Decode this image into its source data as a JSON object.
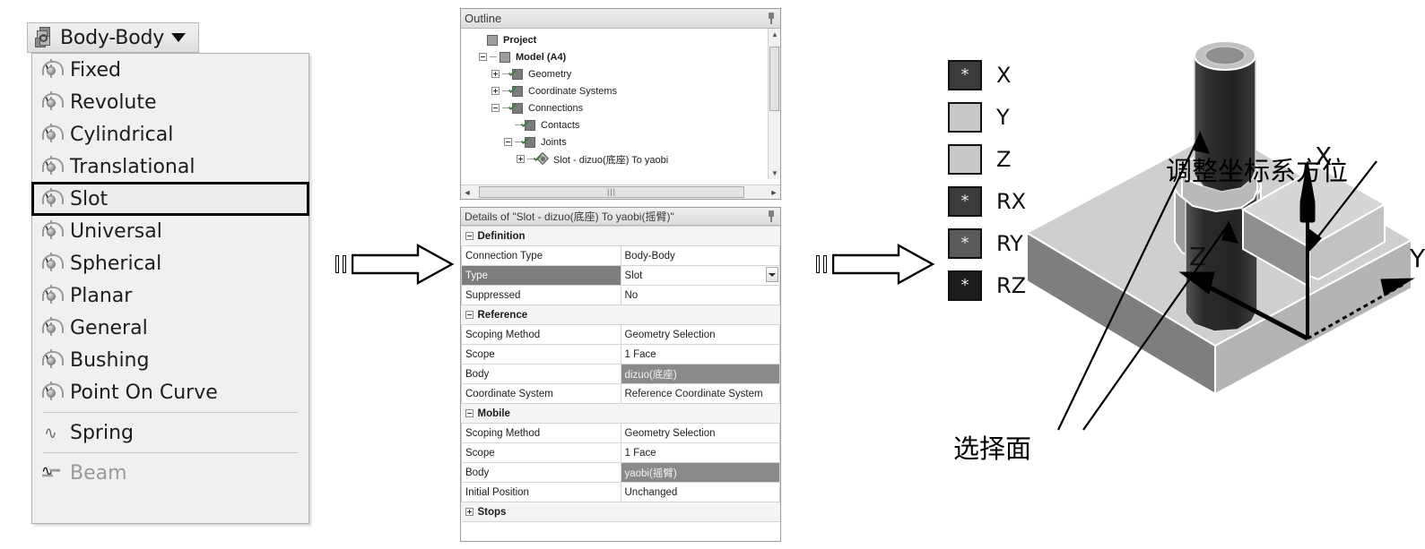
{
  "dropdown": {
    "header_label": "Body-Body",
    "header_icon": "body-body-icon",
    "caret_icon": "chevron-down-icon",
    "items": [
      {
        "label": "Fixed",
        "icon": "joint-icon",
        "state": "normal",
        "selected": false
      },
      {
        "label": "Revolute",
        "icon": "joint-icon",
        "state": "normal",
        "selected": false
      },
      {
        "label": "Cylindrical",
        "icon": "joint-icon",
        "state": "normal",
        "selected": false
      },
      {
        "label": "Translational",
        "icon": "joint-icon",
        "state": "normal",
        "selected": false
      },
      {
        "label": "Slot",
        "icon": "joint-icon",
        "state": "normal",
        "selected": true
      },
      {
        "label": "Universal",
        "icon": "joint-icon",
        "state": "normal",
        "selected": false
      },
      {
        "label": "Spherical",
        "icon": "joint-icon",
        "state": "normal",
        "selected": false
      },
      {
        "label": "Planar",
        "icon": "joint-icon",
        "state": "normal",
        "selected": false
      },
      {
        "label": "General",
        "icon": "joint-icon",
        "state": "normal",
        "selected": false
      },
      {
        "label": "Bushing",
        "icon": "joint-icon",
        "state": "normal",
        "selected": false
      },
      {
        "label": "Point On Curve",
        "icon": "joint-icon",
        "state": "normal",
        "selected": false
      },
      {
        "label": "Spring",
        "icon": "spring-icon",
        "state": "normal",
        "selected": false
      },
      {
        "label": "Beam",
        "icon": "beam-icon",
        "state": "disabled",
        "selected": false
      }
    ]
  },
  "outline": {
    "title": "Outline",
    "pin_icon": "pin-icon",
    "tree": [
      {
        "label": "Project",
        "depth": 0,
        "expander": "none",
        "icon": "project-icon",
        "bold": true
      },
      {
        "label": "Model (A4)",
        "depth": 1,
        "expander": "minus",
        "icon": "model-icon",
        "bold": true
      },
      {
        "label": "Geometry",
        "depth": 2,
        "expander": "plus",
        "icon": "geometry-icon",
        "bold": false
      },
      {
        "label": "Coordinate Systems",
        "depth": 2,
        "expander": "plus",
        "icon": "coordsys-icon",
        "bold": false
      },
      {
        "label": "Connections",
        "depth": 2,
        "expander": "minus",
        "icon": "connections-icon",
        "bold": false
      },
      {
        "label": "Contacts",
        "depth": 3,
        "expander": "none",
        "icon": "contacts-icon",
        "bold": false
      },
      {
        "label": "Joints",
        "depth": 3,
        "expander": "minus",
        "icon": "joints-icon",
        "bold": false
      },
      {
        "label": "Slot - dizuo(底座) To yaobi",
        "depth": 4,
        "expander": "plus",
        "icon": "joint-node-icon",
        "bold": false
      }
    ],
    "hscroll_grip": "|||",
    "scroll_left_icon": "triangle-left-icon",
    "scroll_right_icon": "triangle-right-icon",
    "scroll_up_icon": "triangle-up-icon",
    "scroll_down_icon": "triangle-down-icon"
  },
  "details": {
    "title": "Details of \"Slot - dizuo(底座) To yaobi(摇臂)\"",
    "pin_icon": "pin-icon",
    "rows": [
      {
        "type": "group",
        "label": "Definition",
        "expander": "minus"
      },
      {
        "type": "kv",
        "key": "Connection Type",
        "value": "Body-Body",
        "key_selected": false,
        "value_selected": false,
        "combo": false
      },
      {
        "type": "kv",
        "key": "Type",
        "value": "Slot",
        "key_selected": true,
        "value_selected": false,
        "combo": true
      },
      {
        "type": "kv",
        "key": "Suppressed",
        "value": "No",
        "key_selected": false,
        "value_selected": false,
        "combo": false
      },
      {
        "type": "group",
        "label": "Reference",
        "expander": "minus"
      },
      {
        "type": "kv",
        "key": "Scoping Method",
        "value": "Geometry Selection",
        "key_selected": false,
        "value_selected": false,
        "combo": false
      },
      {
        "type": "kv",
        "key": "Scope",
        "value": "1 Face",
        "key_selected": false,
        "value_selected": false,
        "combo": false
      },
      {
        "type": "kv",
        "key": "Body",
        "value": "dizuo(底座)",
        "key_selected": false,
        "value_selected": true,
        "combo": false
      },
      {
        "type": "kv",
        "key": "Coordinate System",
        "value": "Reference Coordinate System",
        "key_selected": false,
        "value_selected": false,
        "combo": false
      },
      {
        "type": "group",
        "label": "Mobile",
        "expander": "minus"
      },
      {
        "type": "kv",
        "key": "Scoping Method",
        "value": "Geometry Selection",
        "key_selected": false,
        "value_selected": false,
        "combo": false
      },
      {
        "type": "kv",
        "key": "Scope",
        "value": "1 Face",
        "key_selected": false,
        "value_selected": false,
        "combo": false
      },
      {
        "type": "kv",
        "key": "Body",
        "value": "yaobi(摇臂)",
        "key_selected": false,
        "value_selected": true,
        "combo": false
      },
      {
        "type": "kv",
        "key": "Initial Position",
        "value": "Unchanged",
        "key_selected": false,
        "value_selected": false,
        "combo": false
      },
      {
        "type": "group",
        "label": "Stops",
        "expander": "plus"
      }
    ]
  },
  "dof_legend": {
    "rows": [
      {
        "axis": "X",
        "color": "#3c3c3c",
        "marker": "*"
      },
      {
        "axis": "Y",
        "color": "#c8c8c8",
        "marker": ""
      },
      {
        "axis": "Z",
        "color": "#c8c8c8",
        "marker": ""
      },
      {
        "axis": "RX",
        "color": "#3c3c3c",
        "marker": "*"
      },
      {
        "axis": "RY",
        "color": "#5a5a5a",
        "marker": "*"
      },
      {
        "axis": "RZ",
        "color": "#1c1c1c",
        "marker": "*"
      }
    ]
  },
  "annotations": {
    "coord_orientation": "调整坐标系方位",
    "select_face": "选择面"
  },
  "viewport": {
    "axis_x": "X",
    "axis_y": "Y",
    "axis_z": "Z"
  },
  "flow_arrows": {
    "arrow1_icon": "block-arrow-right-icon",
    "arrow2_icon": "block-arrow-right-icon"
  },
  "colors": {
    "selected_row": "#7d7d7d",
    "panel_border": "#9a9a9a",
    "menu_bg": "#f0f0f0",
    "highlight_outline": "#000000"
  }
}
